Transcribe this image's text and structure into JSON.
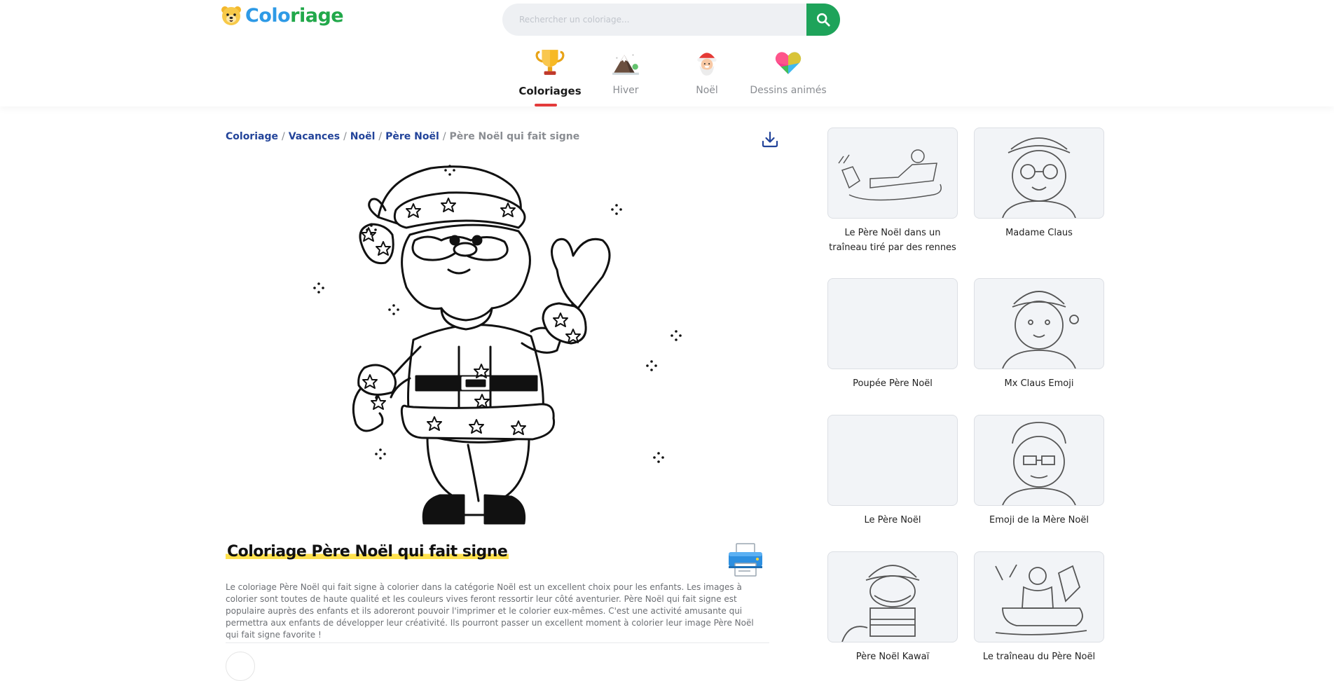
{
  "header": {
    "logo": {
      "part1": "Colo",
      "part2": "riage"
    },
    "search": {
      "placeholder": "Rechercher un coloriage..."
    },
    "nav": [
      {
        "label": "Coloriages",
        "icon": "trophy-icon",
        "active": true
      },
      {
        "label": "Hiver",
        "icon": "winter-hut-icon",
        "active": false
      },
      {
        "label": "Noël",
        "icon": "santa-face-icon",
        "active": false
      },
      {
        "label": "Dessins animés",
        "icon": "heart-puzzle-icon",
        "active": false
      }
    ]
  },
  "breadcrumb": {
    "items": [
      "Coloriage",
      "Vacances",
      "Noël",
      "Père Noël"
    ],
    "current": "Père Noël qui fait signe"
  },
  "page": {
    "title": "Coloriage Père Noël qui fait signe",
    "description": "Le coloriage Père Noël qui fait signe à colorier dans la catégorie Noël est un excellent choix pour les enfants. Les images à colorier sont toutes de haute qualité et les couleurs vives feront ressortir leur côté aventurier. Père Noël qui fait signe est populaire auprès des enfants et ils adoreront pouvoir l'imprimer et le colorier eux-mêmes. C'est une activité amusante qui permettra aux enfants de développer leur créativité. Ils pourront passer un excellent moment à colorier leur image Père Noël qui fait signe favorite !"
  },
  "related": [
    {
      "label": "Le Père Noël dans un traîneau tiré par des rennes"
    },
    {
      "label": "Madame Claus"
    },
    {
      "label": "Poupée Père Noël"
    },
    {
      "label": "Mx Claus Emoji"
    },
    {
      "label": "Le Père Noël"
    },
    {
      "label": "Emoji de la Mère Noël"
    },
    {
      "label": "Père Noël Kawaï"
    },
    {
      "label": "Le traîneau du Père Noël"
    }
  ],
  "colors": {
    "accent_green": "#1ea35a",
    "link_blue": "#23449a",
    "active_underline": "#e33b3b",
    "title_highlight": "#ffe14d"
  }
}
